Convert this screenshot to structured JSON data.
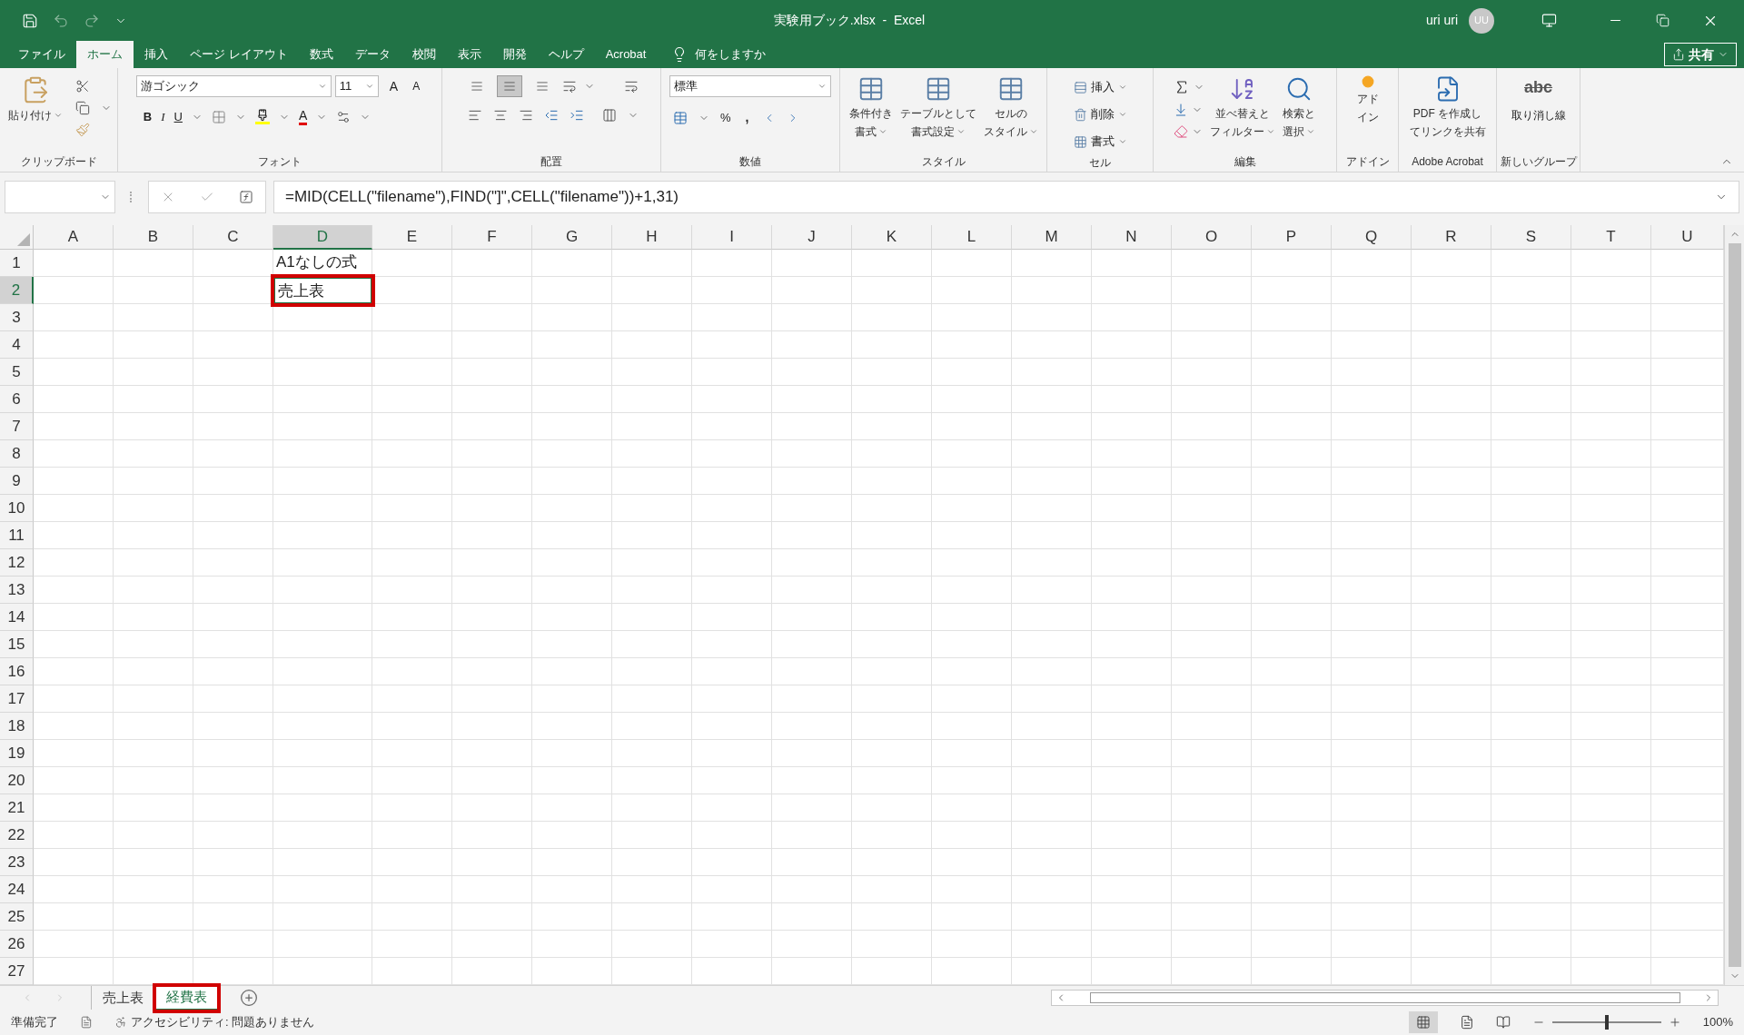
{
  "title_bar": {
    "title": "実験用ブック.xlsx  -  Excel",
    "user": "uri uri",
    "avatar": "UU",
    "share": "共有"
  },
  "ribbon_tabs": [
    {
      "label": "ファイル",
      "selected": false
    },
    {
      "label": "ホーム",
      "selected": true
    },
    {
      "label": "挿入",
      "selected": false
    },
    {
      "label": "ページ レイアウト",
      "selected": false
    },
    {
      "label": "数式",
      "selected": false
    },
    {
      "label": "データ",
      "selected": false
    },
    {
      "label": "校閲",
      "selected": false
    },
    {
      "label": "表示",
      "selected": false
    },
    {
      "label": "開発",
      "selected": false
    },
    {
      "label": "ヘルプ",
      "selected": false
    },
    {
      "label": "Acrobat",
      "selected": false
    }
  ],
  "tell_me": "何をしますか",
  "ribbon": {
    "clipboard": {
      "label": "クリップボード",
      "paste": "貼り付け"
    },
    "font": {
      "label": "フォント",
      "font_name": "游ゴシック",
      "font_size": "11",
      "grow": "A",
      "shrink": "A",
      "bold": "B",
      "italic": "I",
      "underline": "U",
      "font_color": "A"
    },
    "alignment": {
      "label": "配置",
      "vertical": [
        {
          "selected": false
        },
        {
          "selected": true
        },
        {
          "selected": false
        }
      ]
    },
    "number": {
      "label": "数値",
      "format": "標準",
      "percent": "%",
      "comma": ","
    },
    "styles": {
      "label": "スタイル",
      "buttons": [
        {
          "lines": [
            "条件付き",
            "書式"
          ]
        },
        {
          "lines": [
            "テーブルとして",
            "書式設定"
          ]
        },
        {
          "lines": [
            "セルの",
            "スタイル"
          ]
        }
      ]
    },
    "cells": {
      "label": "セル",
      "buttons": [
        "挿入",
        "削除",
        "書式"
      ]
    },
    "editing": {
      "label": "編集",
      "buttons": [
        {
          "lines": [
            "並べ替えと",
            "フィルター"
          ]
        },
        {
          "lines": [
            "検索と",
            "選択"
          ]
        }
      ]
    },
    "addins": {
      "label": "アドイン",
      "lines": [
        "アド",
        "イン"
      ]
    },
    "acrobat": {
      "label": "Adobe Acrobat",
      "lines": [
        "PDF を作成し",
        "てリンクを共有"
      ]
    },
    "new_group": {
      "label": "新しいグループ",
      "icon_text": "abc",
      "button": "取り消し線"
    }
  },
  "formula_bar": {
    "formula": "=MID(CELL(\"filename\"),FIND(\"]\",CELL(\"filename\"))+1,31)"
  },
  "columns": [
    {
      "label": "A",
      "selected": false
    },
    {
      "label": "B",
      "selected": false
    },
    {
      "label": "C",
      "selected": false
    },
    {
      "label": "D",
      "selected": true
    },
    {
      "label": "E",
      "selected": false
    },
    {
      "label": "F",
      "selected": false
    },
    {
      "label": "G",
      "selected": false
    },
    {
      "label": "H",
      "selected": false
    },
    {
      "label": "I",
      "selected": false
    },
    {
      "label": "J",
      "selected": false
    },
    {
      "label": "K",
      "selected": false
    },
    {
      "label": "L",
      "selected": false
    },
    {
      "label": "M",
      "selected": false
    },
    {
      "label": "N",
      "selected": false
    },
    {
      "label": "O",
      "selected": false
    },
    {
      "label": "P",
      "selected": false
    },
    {
      "label": "Q",
      "selected": false
    },
    {
      "label": "R",
      "selected": false
    },
    {
      "label": "S",
      "selected": false
    },
    {
      "label": "T",
      "selected": false
    },
    {
      "label": "U",
      "selected": false
    }
  ],
  "rows": [
    {
      "label": "1",
      "selected": false,
      "column_d": "A1なしの式",
      "highlighted": false
    },
    {
      "label": "2",
      "selected": true,
      "column_d": "売上表",
      "highlighted": true
    },
    {
      "label": "3",
      "selected": false
    },
    {
      "label": "4",
      "selected": false
    },
    {
      "label": "5",
      "selected": false
    },
    {
      "label": "6",
      "selected": false
    },
    {
      "label": "7",
      "selected": false
    },
    {
      "label": "8",
      "selected": false
    },
    {
      "label": "9",
      "selected": false
    },
    {
      "label": "10",
      "selected": false
    },
    {
      "label": "11",
      "selected": false
    },
    {
      "label": "12",
      "selected": false
    },
    {
      "label": "13",
      "selected": false
    },
    {
      "label": "14",
      "selected": false
    },
    {
      "label": "15",
      "selected": false
    },
    {
      "label": "16",
      "selected": false
    },
    {
      "label": "17",
      "selected": false
    },
    {
      "label": "18",
      "selected": false
    },
    {
      "label": "19",
      "selected": false
    },
    {
      "label": "20",
      "selected": false
    },
    {
      "label": "21",
      "selected": false
    },
    {
      "label": "22",
      "selected": false
    },
    {
      "label": "23",
      "selected": false
    },
    {
      "label": "24",
      "selected": false
    },
    {
      "label": "25",
      "selected": false
    },
    {
      "label": "26",
      "selected": false
    },
    {
      "label": "27",
      "selected": false
    }
  ],
  "sheet_tabs": [
    {
      "label": "売上表",
      "selected": false,
      "highlighted": false
    },
    {
      "label": "経費表",
      "selected": true,
      "highlighted": true
    }
  ],
  "status_bar": {
    "ready": "準備完了",
    "accessibility": "アクセシビリティ: 問題ありません",
    "zoom": "100%",
    "zoom_slider": {
      "level": 0.5
    }
  }
}
